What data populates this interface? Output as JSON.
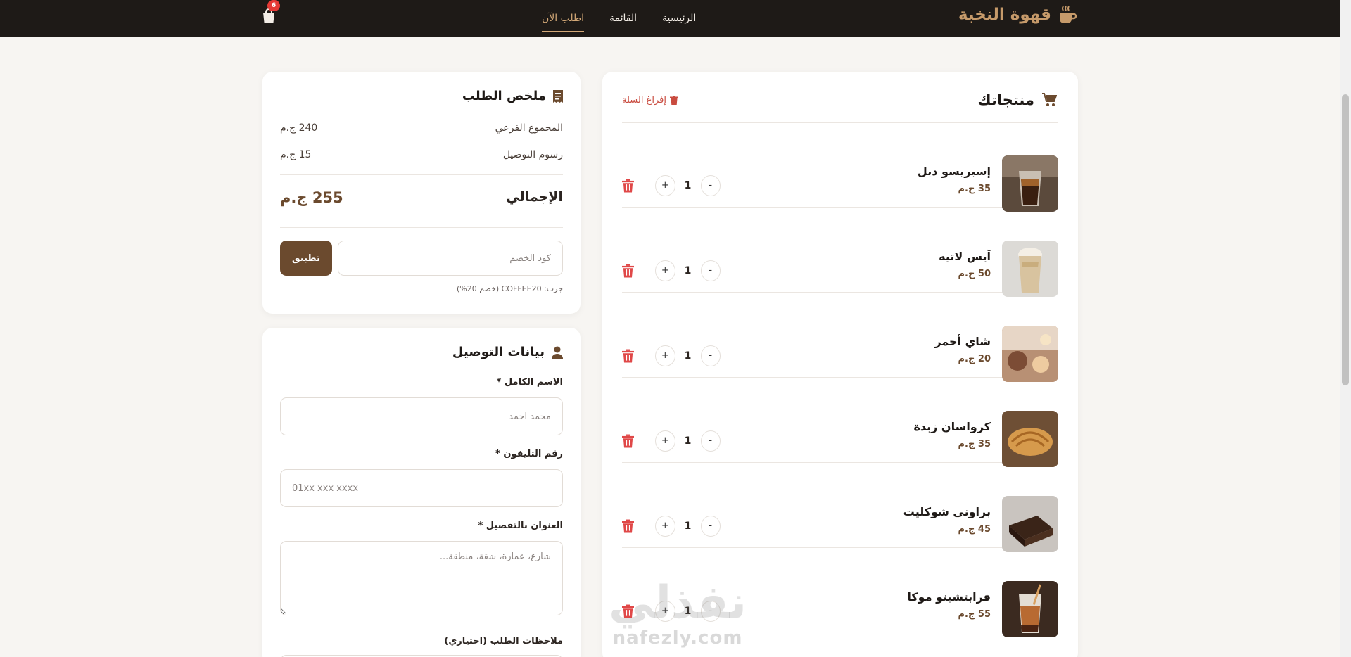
{
  "nav": {
    "brand": "قهوة النخبة",
    "links": [
      {
        "label": "الرئيسية"
      },
      {
        "label": "القائمة"
      },
      {
        "label": "اطلب الآن"
      }
    ],
    "cart_count": "6"
  },
  "products": {
    "title": "منتجاتك",
    "clear_label": "إفراغ السلة",
    "items": [
      {
        "name": "إسبريسو دبل",
        "price": "35 ج.م",
        "qty": "1"
      },
      {
        "name": "آيس لاتيه",
        "price": "50 ج.م",
        "qty": "1"
      },
      {
        "name": "شاي أحمر",
        "price": "20 ج.م",
        "qty": "1"
      },
      {
        "name": "كرواسان زبدة",
        "price": "35 ج.م",
        "qty": "1"
      },
      {
        "name": "براوني شوكليت",
        "price": "45 ج.م",
        "qty": "1"
      },
      {
        "name": "فرابتشينو موكا",
        "price": "55 ج.م",
        "qty": "1"
      }
    ],
    "minus_label": "-",
    "plus_label": "+"
  },
  "summary": {
    "title": "ملخص الطلب",
    "subtotal_label": "المجموع الفرعي",
    "subtotal_value": "240 ج.م",
    "delivery_label": "رسوم التوصيل",
    "delivery_value": "15 ج.م",
    "total_label": "الإجمالي",
    "total_value": "255 ج.م",
    "coupon_placeholder": "كود الخصم",
    "apply_label": "تطبيق",
    "hint": "جرب: COFFEE20 (خصم 20%)"
  },
  "delivery": {
    "title": "بيانات التوصيل",
    "name_label": "الاسم الكامل *",
    "name_placeholder": "محمد أحمد",
    "phone_label": "رقم التليفون *",
    "phone_placeholder": "01xx xxx xxxx",
    "address_label": "العنوان بالتفصيل *",
    "address_placeholder": "شارع، عمارة، شقة، منطقة...",
    "notes_label": "ملاحظات الطلب (اختياري)"
  },
  "watermark": {
    "arabic": "نفذلي",
    "latin": "nafezly.com"
  },
  "colors": {
    "accent": "#6b4a2e",
    "nav_bg": "#1e1a17",
    "brand": "#c69a6a",
    "danger": "#c94b3f"
  }
}
